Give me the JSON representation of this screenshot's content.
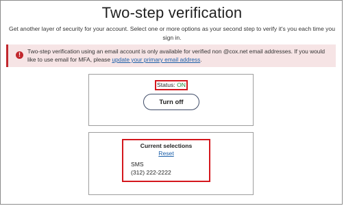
{
  "page": {
    "title": "Two-step verification",
    "subtitle": "Get another layer of security for your account. Select one or more options as your second step to verify it's you each time you sign in."
  },
  "alert": {
    "icon": "exclamation-icon",
    "text_before": "Two-step verification using an email account is only available for verified non @cox.net email addresses. If you would like to use email for MFA, please ",
    "link_text": "update your primary email address",
    "text_after": ".",
    "color": "#c1272d"
  },
  "status": {
    "label": "Status:",
    "value": "ON",
    "value_color": "#1e8a3a",
    "button_label": "Turn off"
  },
  "selections": {
    "heading": "Current selections",
    "reset_label": "Reset",
    "method": "SMS",
    "phone": "(312) 222-2222"
  },
  "colors": {
    "highlight_border": "#d4161c",
    "link": "#1a5ea8"
  }
}
